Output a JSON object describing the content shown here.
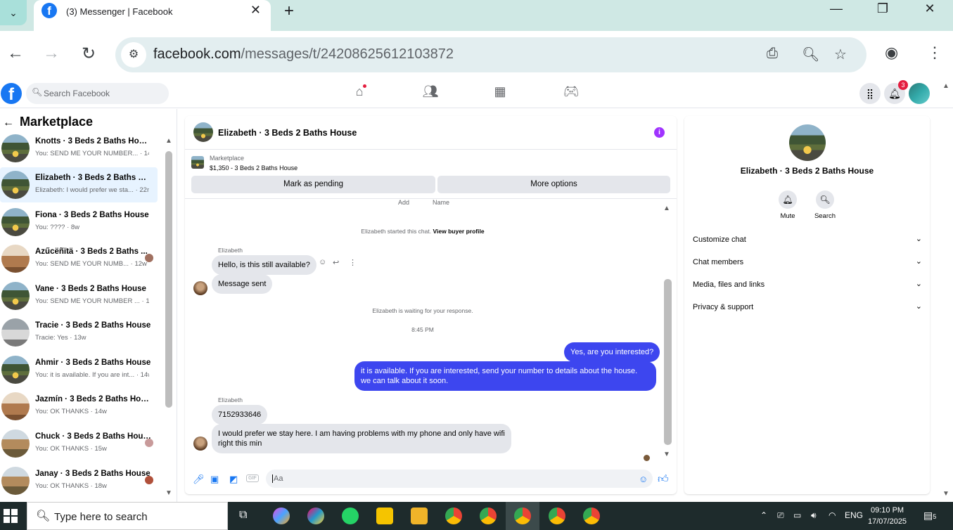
{
  "browser": {
    "tab_title": "(3) Messenger | Facebook",
    "url_domain": "facebook.com",
    "url_path": "/messages/t/24208625612103872"
  },
  "fb": {
    "search_placeholder": "Search Facebook",
    "notif_count": "3"
  },
  "sidebar": {
    "title": "Marketplace",
    "conversations": [
      {
        "name": "Knotts · 3 Beds 2 Baths House",
        "preview": "You: SEND ME YOUR NUMBER... · 14m"
      },
      {
        "name": "Elizabeth · 3 Beds 2 Baths Hou...",
        "preview": "Elizabeth: I would prefer we sta... · 22m"
      },
      {
        "name": "Fiona · 3 Beds 2 Baths House",
        "preview": "You: ???? · 8w"
      },
      {
        "name": "Äzűcëñïtä · 3 Beds 2 Baths ...",
        "preview": "You: SEND ME YOUR NUMB... · 12w"
      },
      {
        "name": "Vane · 3 Beds 2 Baths House",
        "preview": "You: SEND ME YOUR NUMBER ... · 12w"
      },
      {
        "name": "Tracie · 3 Beds 2 Baths House",
        "preview": "Tracie: Yes · 13w"
      },
      {
        "name": "Ahmir · 3 Beds 2 Baths House",
        "preview": "You: it is available. If you are int... · 14w"
      },
      {
        "name": "Jazmín · 3 Beds 2 Baths House",
        "preview": "You: OK THANKS · 14w"
      },
      {
        "name": "Chuck · 3 Beds 2 Baths House",
        "preview": "You: OK THANKS · 15w"
      },
      {
        "name": "Janay · 3 Beds 2 Baths House",
        "preview": "You: OK THANKS · 18w"
      }
    ]
  },
  "chat": {
    "title": "Elizabeth · 3 Beds 2 Baths House",
    "listing_label": "Marketplace",
    "listing_price": "$1,350 - 3 Beds 2 Baths House",
    "mark_pending": "Mark as pending",
    "more_options": "More options",
    "partial_add": "Add",
    "partial_name": "Name",
    "started_text": "Elizabeth started this chat.",
    "view_profile": "View buyer profile",
    "sender1": "Elizabeth",
    "msg1": "Hello, is this still available?",
    "msg2": "Message sent",
    "waiting": "Elizabeth is waiting for your response.",
    "time": "8:45 PM",
    "out1": "Yes, are you interested?",
    "out2_line1": "it is available. If you are interested, send your number to details about the    house.",
    "out2_line2": "we can talk about it soon.",
    "sender2": "Elizabeth",
    "msg3": "7152933646",
    "msg4_line1": "I would prefer we stay here.  I am having problems with my phone and only have wifi",
    "msg4_line2": "right this min",
    "input_placeholder": "Aa"
  },
  "info": {
    "name": "Elizabeth · 3 Beds 2 Baths House",
    "mute": "Mute",
    "search": "Search",
    "rows": [
      "Customize chat",
      "Chat members",
      "Media, files and links",
      "Privacy & support"
    ]
  },
  "taskbar": {
    "search_text": "Type here to search",
    "lang": "ENG",
    "time": "09:10 PM",
    "date": "17/07/2025",
    "notif_count": "5"
  }
}
